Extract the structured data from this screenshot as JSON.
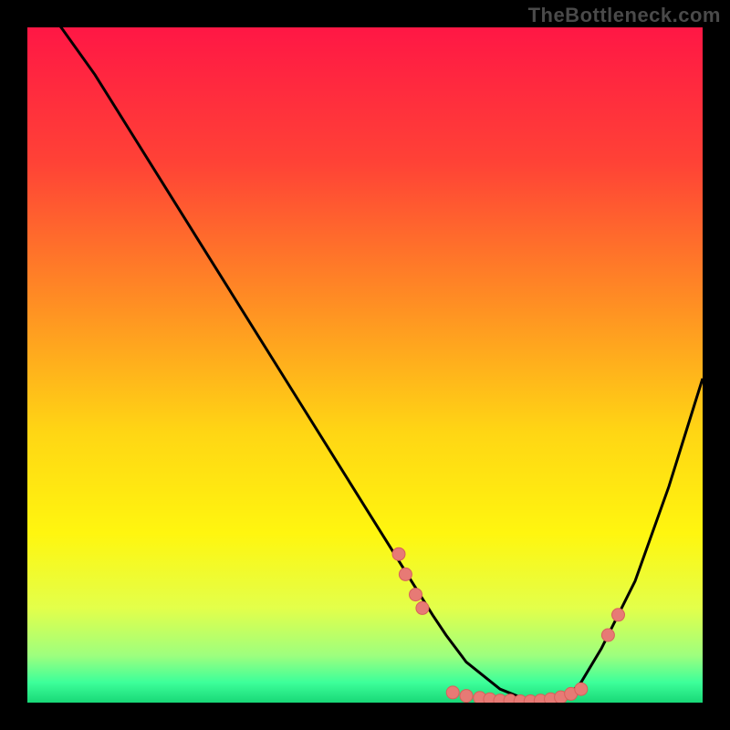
{
  "watermark": "TheBottleneck.com",
  "colors": {
    "background": "#000000",
    "curve": "#000000",
    "marker_fill": "#e77a75",
    "marker_stroke": "#d8605b"
  },
  "chart_data": {
    "type": "line",
    "title": "",
    "xlabel": "",
    "ylabel": "",
    "xlim": [
      0,
      100
    ],
    "ylim": [
      0,
      100
    ],
    "gradient_stops": [
      {
        "offset": 0,
        "color": "#ff1745"
      },
      {
        "offset": 20,
        "color": "#ff4236"
      },
      {
        "offset": 40,
        "color": "#ff8b24"
      },
      {
        "offset": 60,
        "color": "#ffd614"
      },
      {
        "offset": 75,
        "color": "#fff60f"
      },
      {
        "offset": 86,
        "color": "#e3ff4a"
      },
      {
        "offset": 93,
        "color": "#9eff7e"
      },
      {
        "offset": 97,
        "color": "#3dff9a"
      },
      {
        "offset": 100,
        "color": "#18d877"
      }
    ],
    "series": [
      {
        "name": "curve",
        "x": [
          0,
          5,
          10,
          15,
          20,
          25,
          30,
          35,
          40,
          45,
          50,
          55,
          60,
          62,
          65,
          70,
          75,
          80,
          82,
          85,
          90,
          95,
          100
        ],
        "values": [
          106,
          100,
          93,
          85,
          77,
          69,
          61,
          53,
          45,
          37,
          29,
          21,
          13,
          10,
          6,
          2,
          0,
          1,
          3,
          8,
          18,
          32,
          48
        ]
      }
    ],
    "markers": [
      {
        "x": 55.0,
        "y": 22
      },
      {
        "x": 56.0,
        "y": 19
      },
      {
        "x": 57.5,
        "y": 16
      },
      {
        "x": 58.5,
        "y": 14
      },
      {
        "x": 63.0,
        "y": 1.5
      },
      {
        "x": 65.0,
        "y": 1.0
      },
      {
        "x": 67.0,
        "y": 0.7
      },
      {
        "x": 68.5,
        "y": 0.5
      },
      {
        "x": 70.0,
        "y": 0.3
      },
      {
        "x": 71.5,
        "y": 0.3
      },
      {
        "x": 73.0,
        "y": 0.2
      },
      {
        "x": 74.5,
        "y": 0.2
      },
      {
        "x": 76.0,
        "y": 0.3
      },
      {
        "x": 77.5,
        "y": 0.5
      },
      {
        "x": 79.0,
        "y": 0.8
      },
      {
        "x": 80.5,
        "y": 1.3
      },
      {
        "x": 82.0,
        "y": 2.0
      },
      {
        "x": 86.0,
        "y": 10
      },
      {
        "x": 87.5,
        "y": 13
      }
    ]
  }
}
